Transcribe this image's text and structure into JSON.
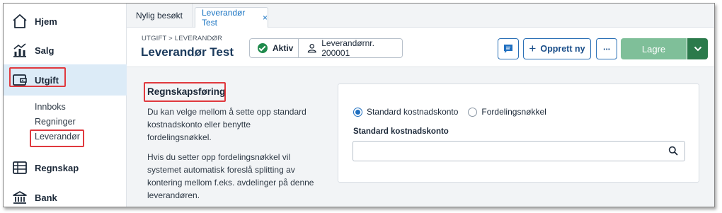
{
  "sidebar": {
    "items": [
      {
        "label": "Hjem",
        "icon": "home-icon"
      },
      {
        "label": "Salg",
        "icon": "chart-icon"
      },
      {
        "label": "Utgift",
        "icon": "wallet-icon",
        "active": true
      },
      {
        "label": "Regnskap",
        "icon": "ledger-icon"
      },
      {
        "label": "Bank",
        "icon": "bank-icon"
      }
    ],
    "subitems": [
      "Innboks",
      "Regninger",
      "Leverandør"
    ]
  },
  "tabs": {
    "recent_label": "Nylig besøkt",
    "active_label": "Leverandør Test",
    "close_glyph": "×"
  },
  "header": {
    "breadcrumb": "UTGIFT > LEVERANDØR",
    "title": "Leverandør Test",
    "status": "Aktiv",
    "supplier_number": "Leverandørnr. 200001",
    "new_button": "Opprett ny",
    "more_glyph": "···",
    "save_button": "Lagre"
  },
  "main": {
    "section_title": "Regnskapsføring",
    "paragraph1": "Du kan velge mellom å sette opp standard kostnadskonto eller benytte fordelingsnøkkel.",
    "paragraph2": "Hvis du setter opp fordelingsnøkkel vil systemet automatisk foreslå splitting av kontering mellom f.eks. avdelinger på denne leverandøren.",
    "radio_standard": "Standard kostnadskonto",
    "radio_distribution": "Fordelingsnøkkel",
    "field_label": "Standard kostnadskonto",
    "field_value": ""
  },
  "colors": {
    "accent": "#1873c2",
    "active_nav_bg": "#dcebf7",
    "save_bg": "#7fbf99",
    "save_caret_bg": "#2b7a4b",
    "annotation_red": "#e0393e"
  }
}
